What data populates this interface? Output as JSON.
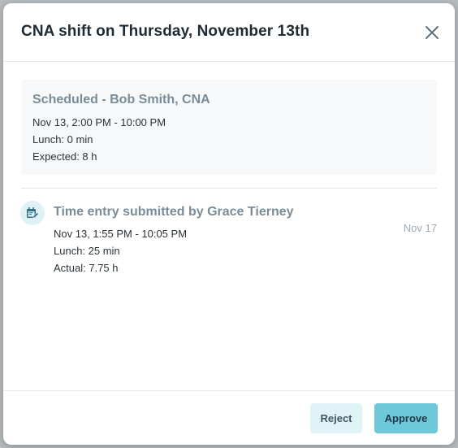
{
  "modal": {
    "title": "CNA shift on Thursday, November 13th"
  },
  "scheduled": {
    "heading": "Scheduled - Bob Smith, CNA",
    "time": "Nov 13, 2:00 PM - 10:00 PM",
    "lunch": "Lunch: 0 min",
    "expected": "Expected: 8 h"
  },
  "time_entry": {
    "icon": "edit-calendar-icon",
    "heading": "Time entry submitted by Grace Tierney",
    "date": "Nov 17",
    "time": "Nov 13, 1:55 PM - 10:05 PM",
    "lunch": "Lunch: 25 min",
    "actual": "Actual: 7.75 h"
  },
  "footer": {
    "reject_label": "Reject",
    "approve_label": "Approve"
  },
  "colors": {
    "accent": "#6ec8da",
    "accent_light": "#e0f3f7",
    "muted_heading": "#7a8c98"
  }
}
